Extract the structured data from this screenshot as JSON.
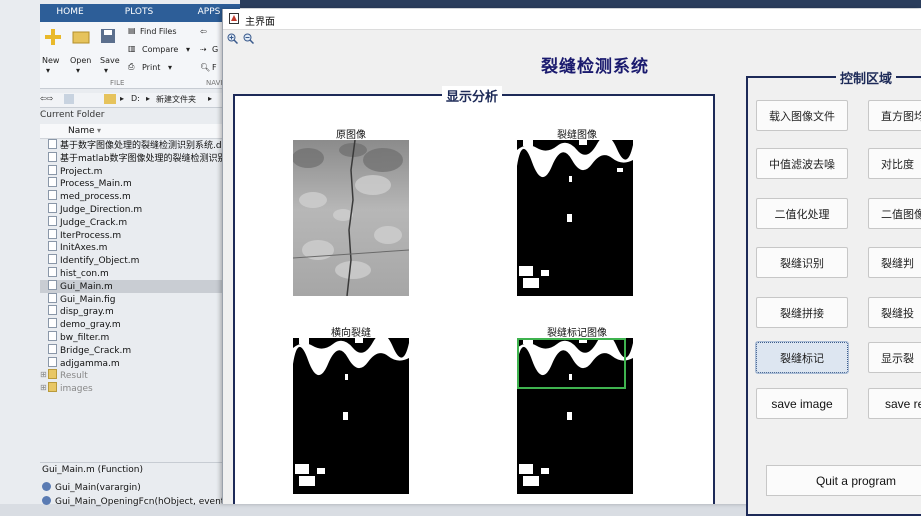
{
  "matlab": {
    "tabs": [
      "HOME",
      "PLOTS",
      "APPS"
    ],
    "ribbon": {
      "find_files": "Find Files",
      "compare": "Compare",
      "print": "Print",
      "new": "New",
      "open": "Open",
      "save": "Save",
      "file_group": "FILE",
      "navi_group": "NAVI",
      "go_fragment": "G",
      "f_fragment": "F"
    },
    "address": [
      "D:",
      "新建文件夹"
    ],
    "current_folder": "Current Folder",
    "name_header": "Name",
    "files": [
      {
        "name": "基于数字图像处理的裂缝检测识别系统.d",
        "kind": "doc"
      },
      {
        "name": "基于matlab数字图像处理的裂缝检测识别",
        "kind": "doc"
      },
      {
        "name": "Project.m",
        "kind": "m"
      },
      {
        "name": "Process_Main.m",
        "kind": "m"
      },
      {
        "name": "med_process.m",
        "kind": "m"
      },
      {
        "name": "Judge_Direction.m",
        "kind": "m"
      },
      {
        "name": "Judge_Crack.m",
        "kind": "m"
      },
      {
        "name": "IterProcess.m",
        "kind": "m"
      },
      {
        "name": "InitAxes.m",
        "kind": "m"
      },
      {
        "name": "Identify_Object.m",
        "kind": "m"
      },
      {
        "name": "hist_con.m",
        "kind": "m"
      },
      {
        "name": "Gui_Main.m",
        "kind": "m",
        "selected": true
      },
      {
        "name": "Gui_Main.fig",
        "kind": "fig"
      },
      {
        "name": "disp_gray.m",
        "kind": "m"
      },
      {
        "name": "demo_gray.m",
        "kind": "m"
      },
      {
        "name": "bw_filter.m",
        "kind": "m"
      },
      {
        "name": "Bridge_Crack.m",
        "kind": "m"
      },
      {
        "name": "adjgamma.m",
        "kind": "m"
      },
      {
        "name": "Result",
        "kind": "folder"
      },
      {
        "name": "images",
        "kind": "folder"
      }
    ],
    "details_title": "Gui_Main.m  (Function)",
    "details": [
      "Gui_Main(varargin)",
      "Gui_Main_OpeningFcn(hObject, event"
    ]
  },
  "figure": {
    "window_title": "主界面",
    "app_title": "裂缝检测系统",
    "display_panel_title": "显示分析",
    "control_panel_title": "控制区域",
    "image_labels": {
      "original": "原图像",
      "crack": "裂缝图像",
      "horizontal": "横向裂缝",
      "marked": "裂缝标记图像"
    },
    "buttons": [
      "载入图像文件",
      "直方图均",
      "中值滤波去噪",
      "对比度",
      "二值化处理",
      "二值图像",
      "裂缝识别",
      "裂缝判",
      "裂缝拼接",
      "裂缝投",
      "裂缝标记",
      "显示裂",
      "save image",
      "save re"
    ],
    "quit_button": "Quit a program"
  }
}
